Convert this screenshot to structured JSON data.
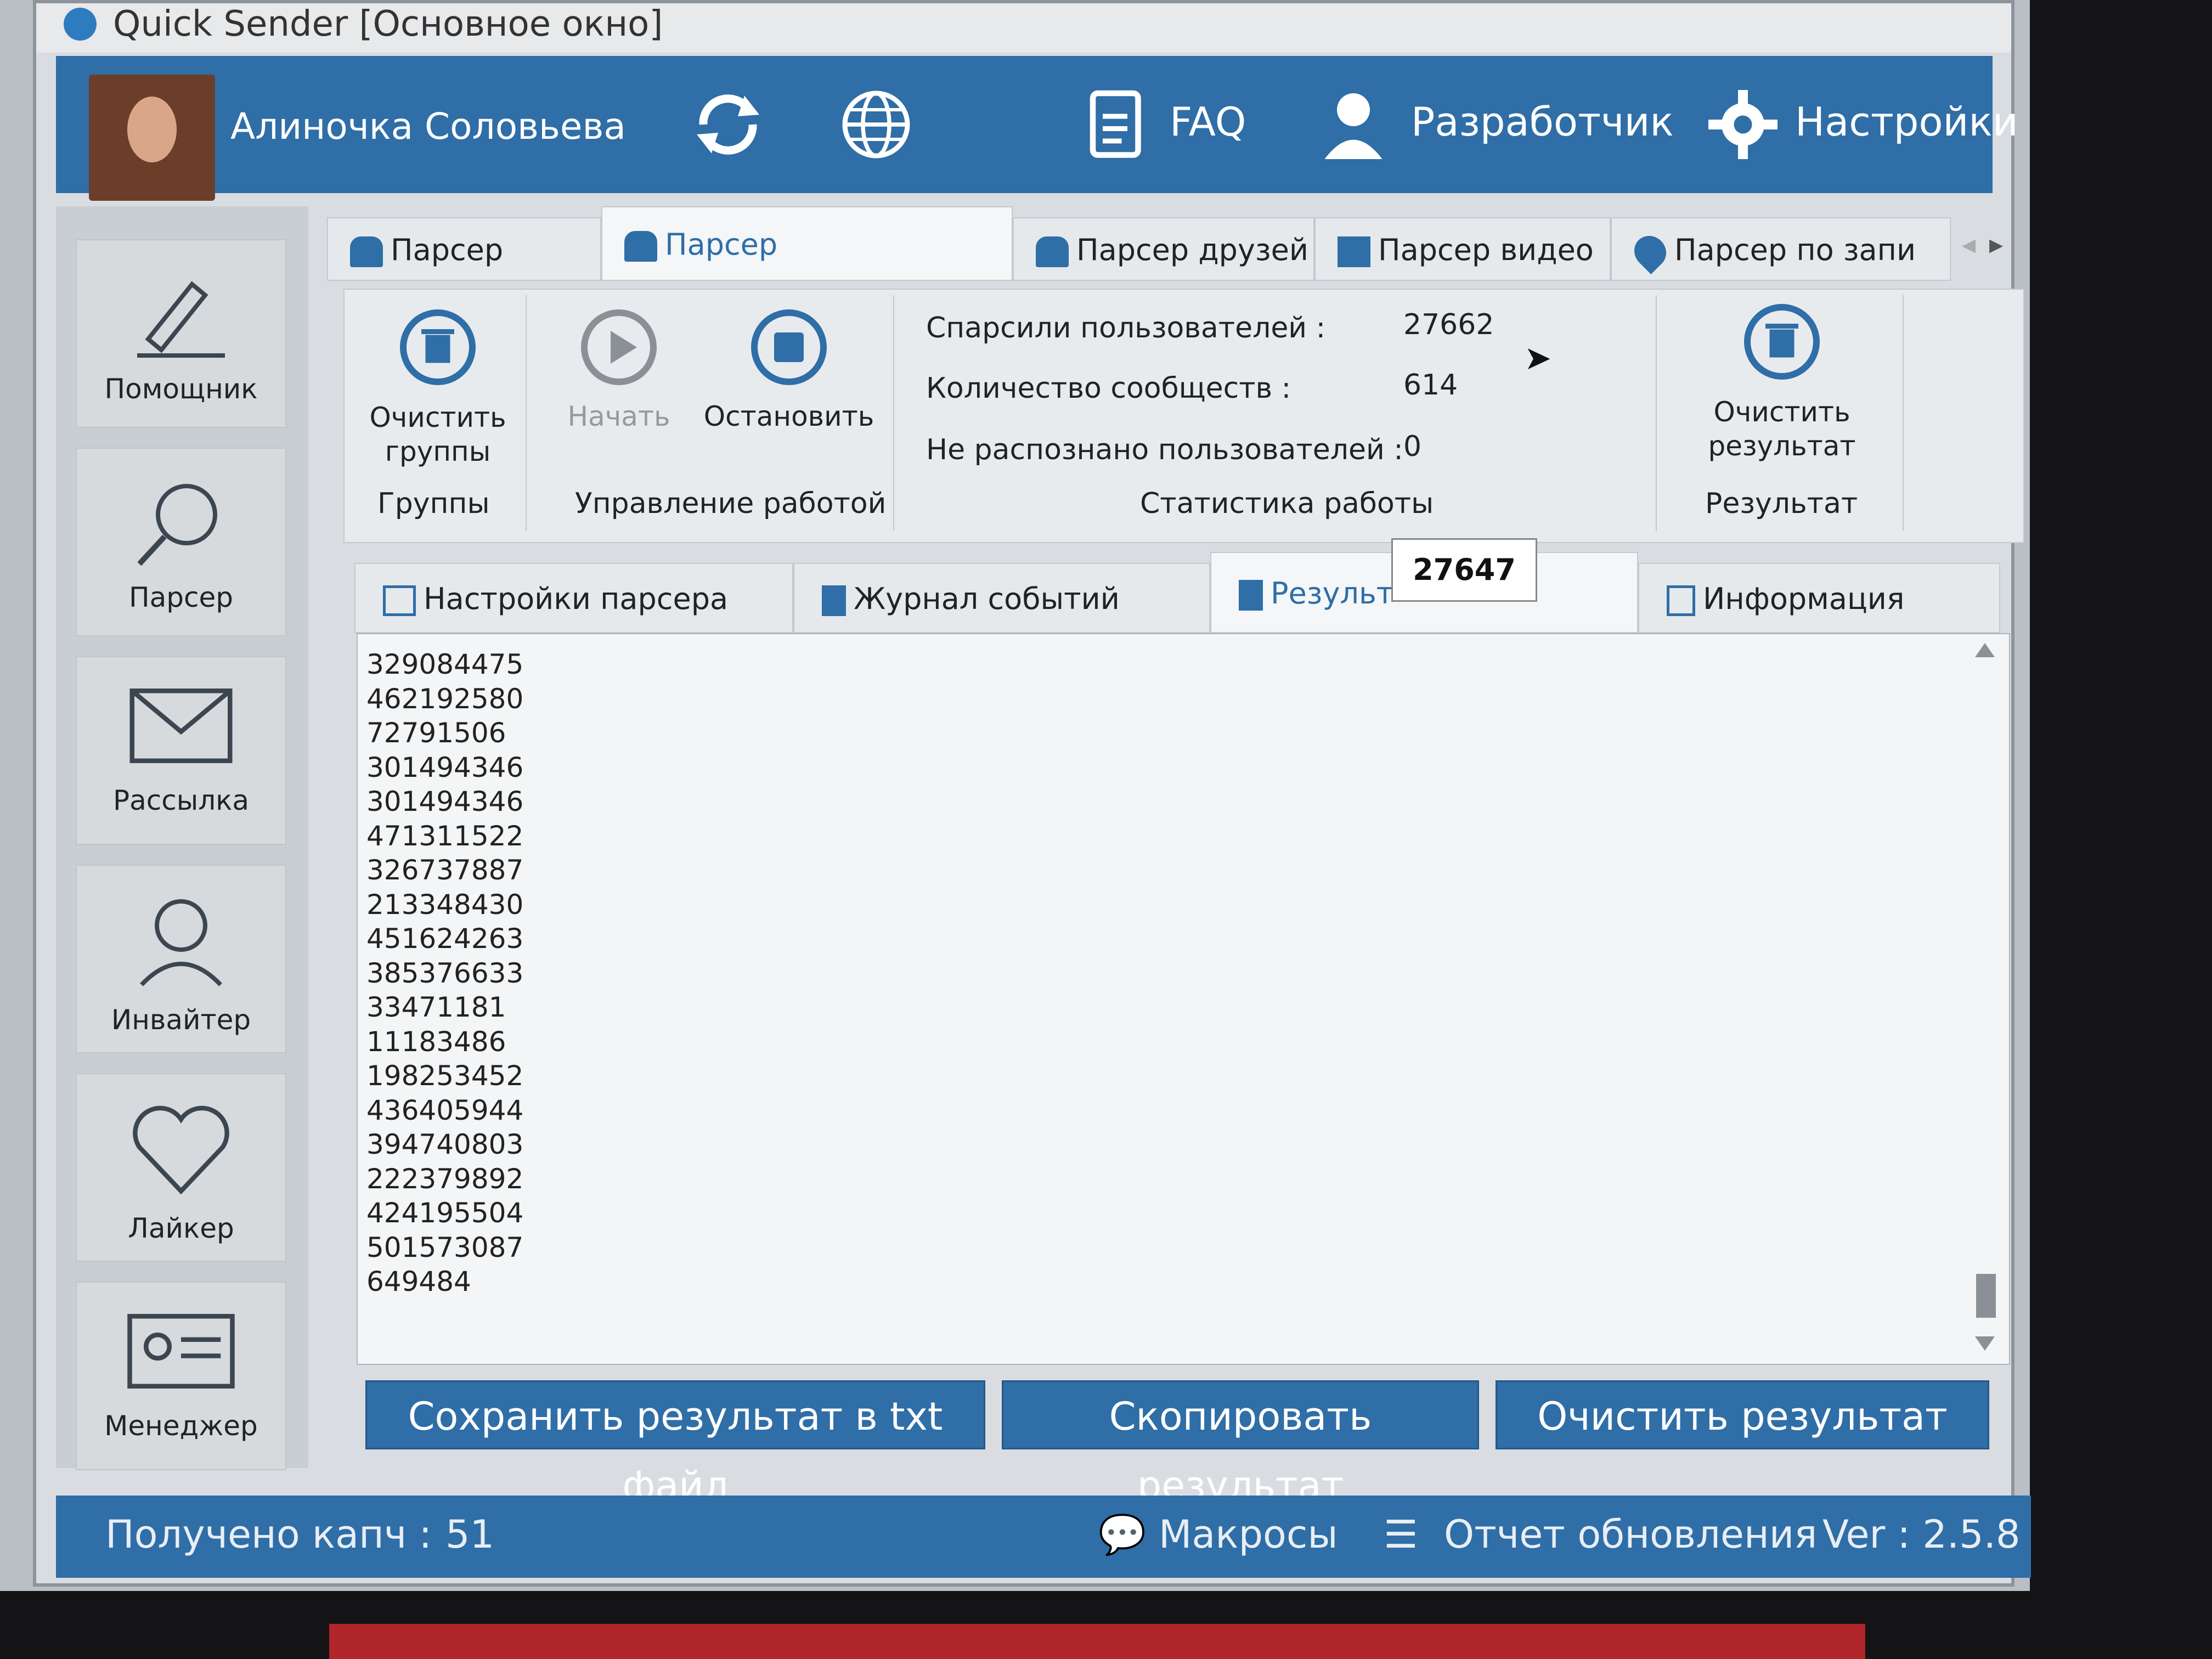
{
  "window": {
    "title": "Quick Sender [Основное окно]"
  },
  "header": {
    "user_name": "Алиночка Соловьева",
    "faq_label": "FAQ",
    "developer_label": "Разработчик",
    "settings_label": "Настройки"
  },
  "sidebar": {
    "items": [
      {
        "label": "Помощник",
        "icon": "pencil-icon"
      },
      {
        "label": "Парсер",
        "icon": "magnifier-icon"
      },
      {
        "label": "Рассылка",
        "icon": "envelope-icon"
      },
      {
        "label": "Инвайтер",
        "icon": "user-icon"
      },
      {
        "label": "Лайкер",
        "icon": "heart-icon"
      },
      {
        "label": "Менеджер",
        "icon": "id-card-icon"
      }
    ]
  },
  "top_tabs": [
    {
      "label": "Парсер групп"
    },
    {
      "label": "Парсер пользователей"
    },
    {
      "label": "Парсер друзей"
    },
    {
      "label": "Парсер видео"
    },
    {
      "label": "Парсер по запи"
    }
  ],
  "ribbon": {
    "clear_groups": "Очистить группы",
    "start": "Начать",
    "stop": "Остановить",
    "group_groups": "Группы",
    "group_control": "Управление работой",
    "group_stats": "Статистика работы",
    "clear_result": "Очистить результат",
    "group_result": "Результат",
    "stats": [
      {
        "label": "Спарсили пользователей :",
        "value": "27662"
      },
      {
        "label": "Количество сообществ :",
        "value": "614"
      },
      {
        "label": "Не распознано пользователей :",
        "value": "0"
      }
    ]
  },
  "mid_tabs": [
    {
      "label": "Настройки парсера"
    },
    {
      "label": "Журнал событий"
    },
    {
      "label": "Результ"
    },
    {
      "label": "Информация"
    }
  ],
  "tooltip": "27647",
  "results": [
    "329084475",
    "462192580",
    "72791506",
    "301494346",
    "301494346",
    "471311522",
    "326737887",
    "213348430",
    "451624263",
    "385376633",
    "33471181",
    "11183486",
    "198253452",
    "436405944",
    "394740803",
    "222379892",
    "424195504",
    "501573087",
    "649484"
  ],
  "actions": {
    "save": "Сохранить результат в txt файл",
    "copy": "Скопировать результат",
    "clear": "Очистить результат"
  },
  "status": {
    "captcha_label": "Получено капч :",
    "captcha_value": "51",
    "macros": "Макросы",
    "update_report": "Отчет обновления",
    "version": "Ver : 2.5.8"
  },
  "colors": {
    "accent": "#2f6ea7"
  }
}
